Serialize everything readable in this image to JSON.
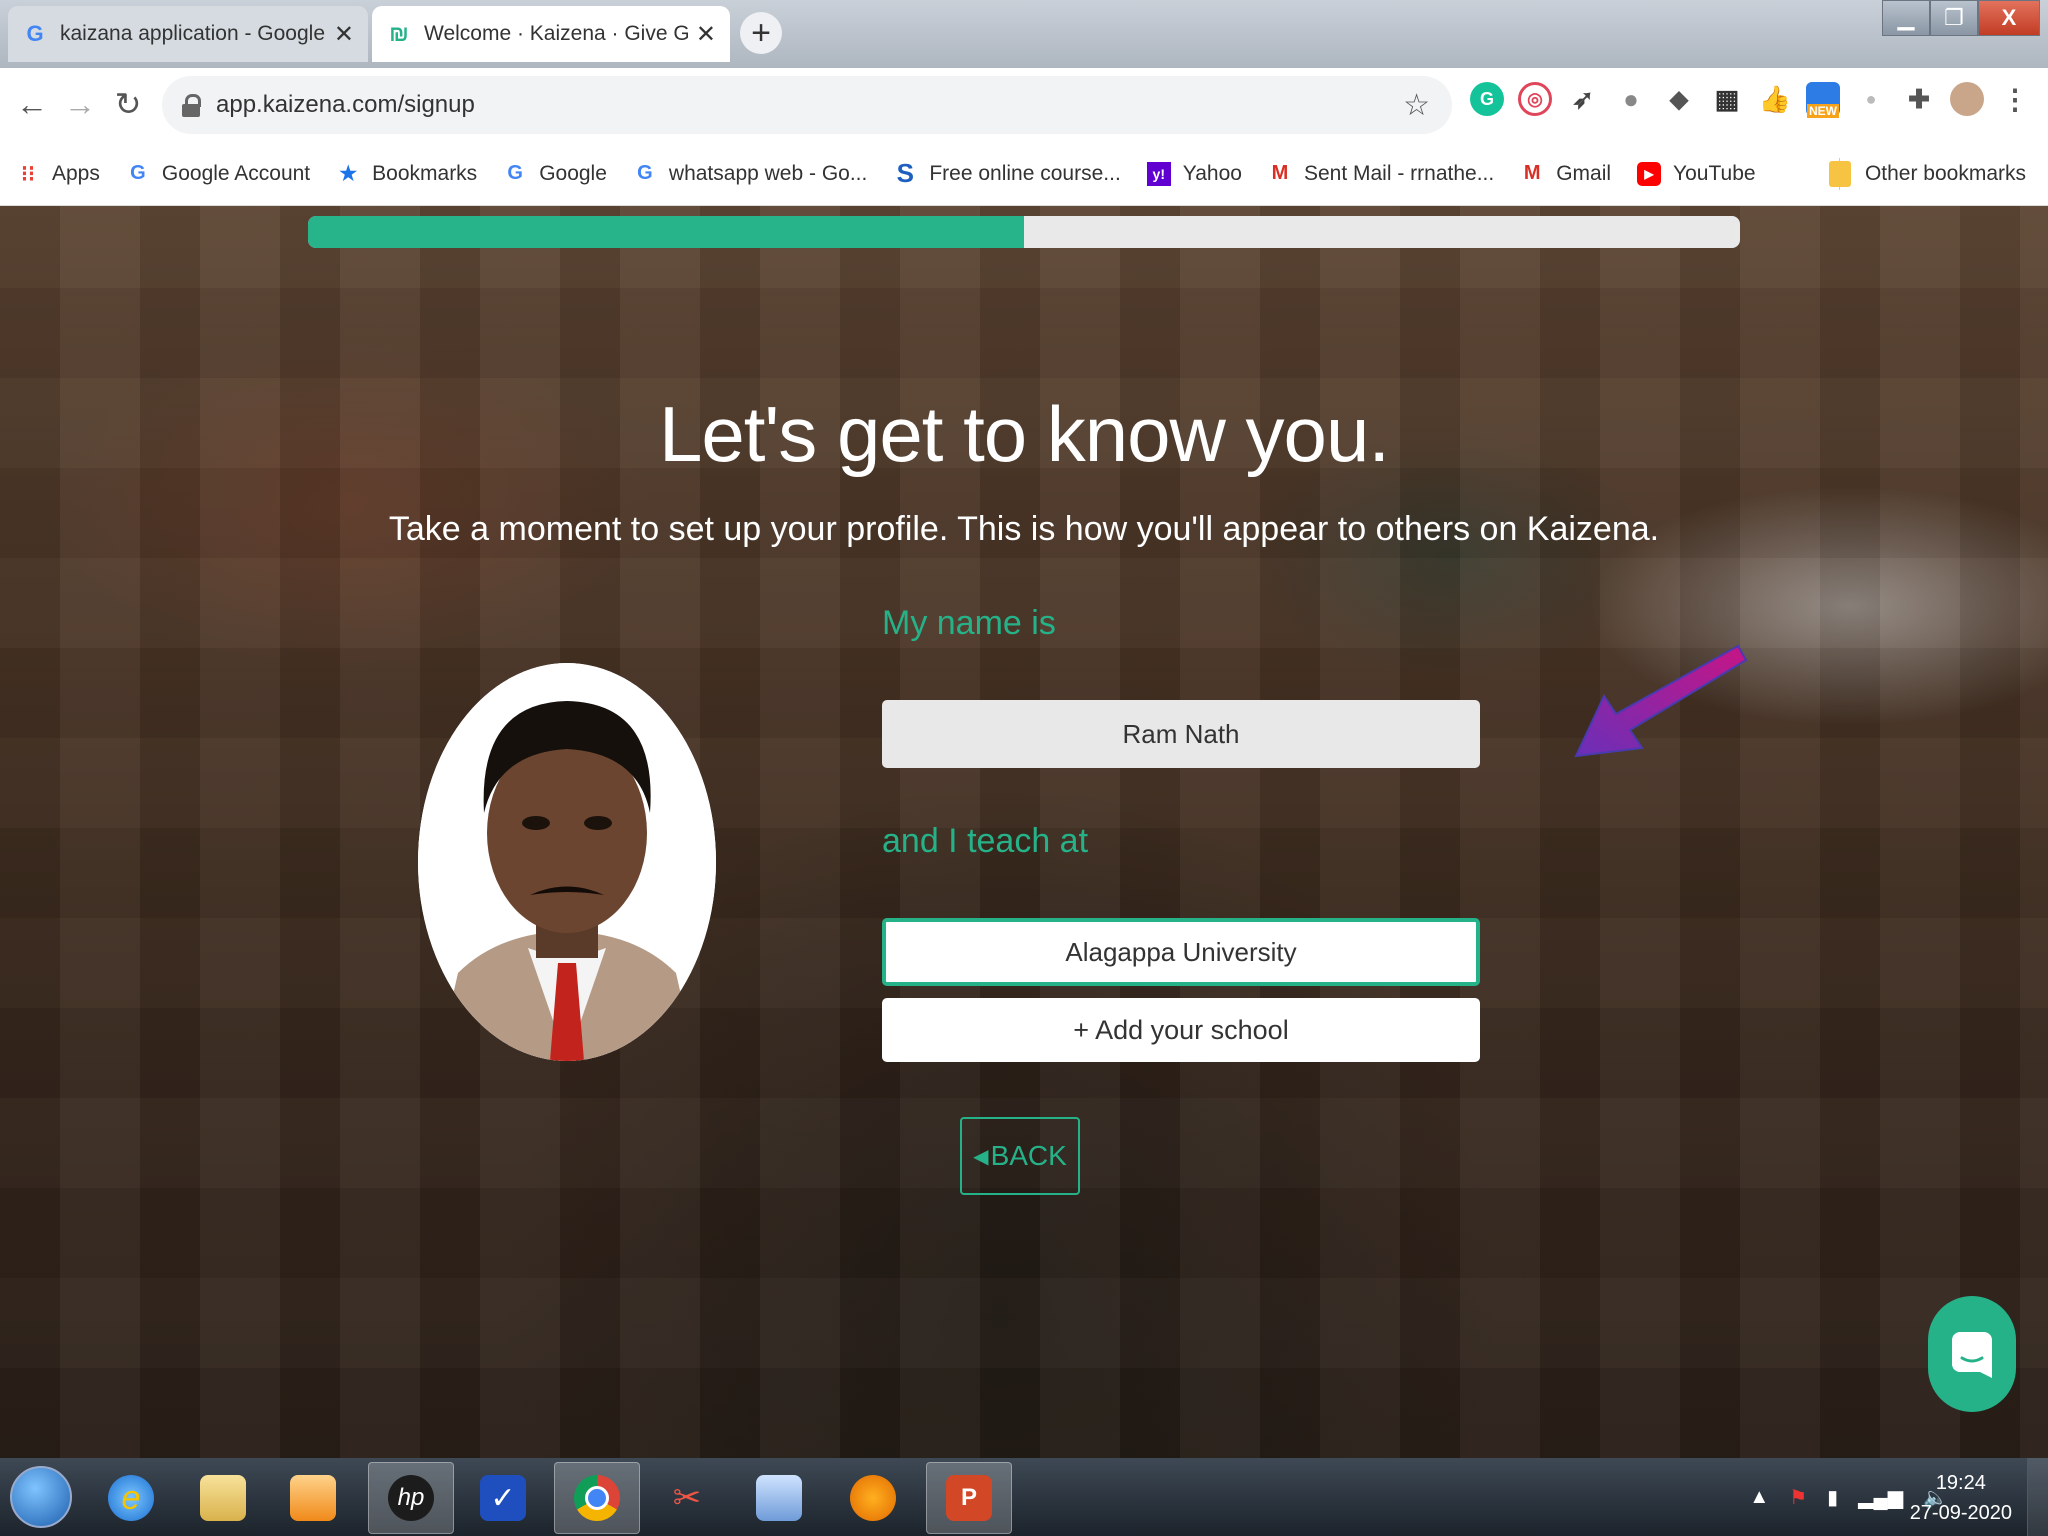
{
  "browser": {
    "tabs": [
      {
        "title": "kaizana application - Google Sea",
        "active": false,
        "favicon": "google-g"
      },
      {
        "title": "Welcome · Kaizena · Give Great F",
        "active": true,
        "favicon": "kaizena"
      }
    ],
    "new_tab": "+",
    "url": "app.kaizena.com/signup",
    "extensions": [
      "grammarly-icon",
      "extension-icon",
      "rocket-icon",
      "extension-icon",
      "extension-icon",
      "grid-icon",
      "thumbs-up-icon",
      "new-badge-icon",
      "extension-icon",
      "puzzle-icon",
      "profile-avatar"
    ],
    "bookmarks": [
      {
        "label": "Apps",
        "icon": "apps-grid-icon"
      },
      {
        "label": "Google Account",
        "icon": "google-icon"
      },
      {
        "label": "Bookmarks",
        "icon": "star-icon"
      },
      {
        "label": "Google",
        "icon": "google-icon"
      },
      {
        "label": "whatsapp web - Go...",
        "icon": "google-icon"
      },
      {
        "label": "Free online course...",
        "icon": "s-icon"
      },
      {
        "label": "Yahoo",
        "icon": "yahoo-icon"
      },
      {
        "label": "Sent Mail - rrnathe...",
        "icon": "gmail-icon"
      },
      {
        "label": "Gmail",
        "icon": "gmail-icon"
      },
      {
        "label": "YouTube",
        "icon": "youtube-icon"
      }
    ],
    "other_bookmarks": "Other bookmarks"
  },
  "signup": {
    "progress_fraction": 0.5,
    "heading": "Let's get to know you.",
    "subtitle": "Take a moment to set up your profile. This is how you'll appear to others on Kaizena.",
    "name_label": "My name is",
    "name_value": "Ram Nath",
    "school_label": "and I teach at",
    "school_value": "Alagappa University",
    "add_school": "+ Add your school",
    "back": "BACK"
  },
  "colors": {
    "accent": "#26b289",
    "annotation_arrow": "#b0179c"
  },
  "taskbar": {
    "apps": [
      "internet-explorer-icon",
      "file-explorer-icon",
      "media-player-icon",
      "hp-icon",
      "checkmark-app-icon",
      "chrome-icon",
      "snipping-tool-icon",
      "keyboard-icon",
      "vpn-shield-icon",
      "powerpoint-icon"
    ],
    "time": "19:24",
    "date": "27-09-2020"
  }
}
